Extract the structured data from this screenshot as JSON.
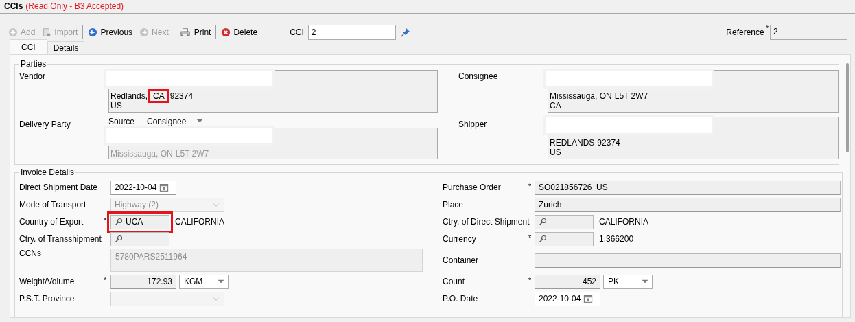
{
  "title": "CCIs",
  "status": "(Read Only - B3 Accepted)",
  "toolbar": {
    "groups": [
      [
        {
          "kind": "add",
          "label": "Add",
          "disabled": true
        },
        {
          "kind": "import",
          "label": "Import",
          "disabled": true
        }
      ],
      [
        {
          "kind": "previous",
          "label": "Previous",
          "disabled": false
        },
        {
          "kind": "next",
          "label": "Next",
          "disabled": true
        }
      ],
      [
        {
          "kind": "print",
          "label": "Print",
          "disabled": false
        }
      ],
      [
        {
          "kind": "delete",
          "label": "Delete",
          "disabled": false
        }
      ]
    ],
    "cci": {
      "label": "CCI",
      "value": "2"
    },
    "reference": {
      "label": "Reference",
      "value": "2",
      "asterisk": "*"
    }
  },
  "tabs": [
    {
      "label": "CCI",
      "selected": true
    },
    {
      "label": "Details",
      "selected": false
    }
  ],
  "parties": {
    "title": "Parties",
    "items": [
      {
        "label": "Vendor",
        "redacted": true,
        "disabled": false,
        "lines": [
          [
            {
              "text": "Redlands,",
              "highlighted": false
            },
            {
              "text": "CA",
              "highlighted": true
            },
            {
              "text": "92374",
              "highlighted": false
            }
          ],
          [
            {
              "text": "US",
              "highlighted": false
            }
          ]
        ]
      },
      {
        "label": "Consignee",
        "redacted": true,
        "disabled": false,
        "lines": [
          [
            {
              "text": "Mississauga, ON",
              "highlighted": false
            },
            {
              "text": "L5T 2W7",
              "highlighted": false
            }
          ],
          [
            {
              "text": "CA",
              "highlighted": false
            }
          ]
        ]
      },
      {
        "label": "Delivery Party",
        "redacted": true,
        "disabled": true,
        "source": {
          "label": "Source",
          "value": "Consignee"
        },
        "lines": [
          [
            {
              "text": "Mississauga, ON",
              "highlighted": false
            },
            {
              "text": "L5T 2W7",
              "highlighted": false
            }
          ]
        ]
      },
      {
        "label": "Shipper",
        "redacted": true,
        "disabled": false,
        "lines": [
          [
            {
              "text": "REDLANDS",
              "highlighted": false
            },
            {
              "text": "92374",
              "highlighted": false
            }
          ],
          [
            {
              "text": "US",
              "highlighted": false
            }
          ]
        ]
      }
    ]
  },
  "invoice": {
    "title": "Invoice Details",
    "rows": [
      {
        "left": {
          "kind": "date",
          "label": "Direct Shipment Date",
          "value": "2022-10-04"
        },
        "right": {
          "kind": "text",
          "label": "Purchase Order",
          "value": "SO021856726_US",
          "asterisk": "*"
        }
      },
      {
        "left": {
          "kind": "select",
          "label": "Mode of Transport",
          "value": "Highway (2)",
          "disabled": true
        },
        "right": {
          "kind": "text",
          "label": "Place",
          "value": "Zurich"
        }
      },
      {
        "left": {
          "kind": "lookup",
          "label": "Country of Export",
          "value": "UCA",
          "description": "CALIFORNIA",
          "asterisk": "*",
          "highlighted": true
        },
        "right": {
          "kind": "lookup",
          "label": "Ctry. of Direct Shipment",
          "description": "CALIFORNIA"
        }
      },
      {
        "left": {
          "kind": "lookup",
          "label": "Ctry. of Transshipment"
        },
        "right": {
          "kind": "lookup",
          "label": "Currency",
          "description": "1.366200",
          "asterisk": "*"
        }
      },
      {
        "left": {
          "kind": "textarea",
          "label": "CCNs",
          "value": "5780PARS2511964"
        },
        "right": {
          "kind": "text",
          "label": "Container"
        }
      },
      {
        "left": {
          "kind": "measure",
          "label": "Weight/Volume",
          "value": "172.93",
          "unit": "KGM",
          "asterisk": "*"
        },
        "right": {
          "kind": "measure",
          "label": "Count",
          "value": "452",
          "unit": "PK",
          "asterisk": "*"
        }
      },
      {
        "left": {
          "kind": "select",
          "label": "P.S.T. Province",
          "disabled": true
        },
        "right": {
          "kind": "date",
          "label": "P.O. Date",
          "value": "2022-10-04"
        }
      }
    ]
  }
}
